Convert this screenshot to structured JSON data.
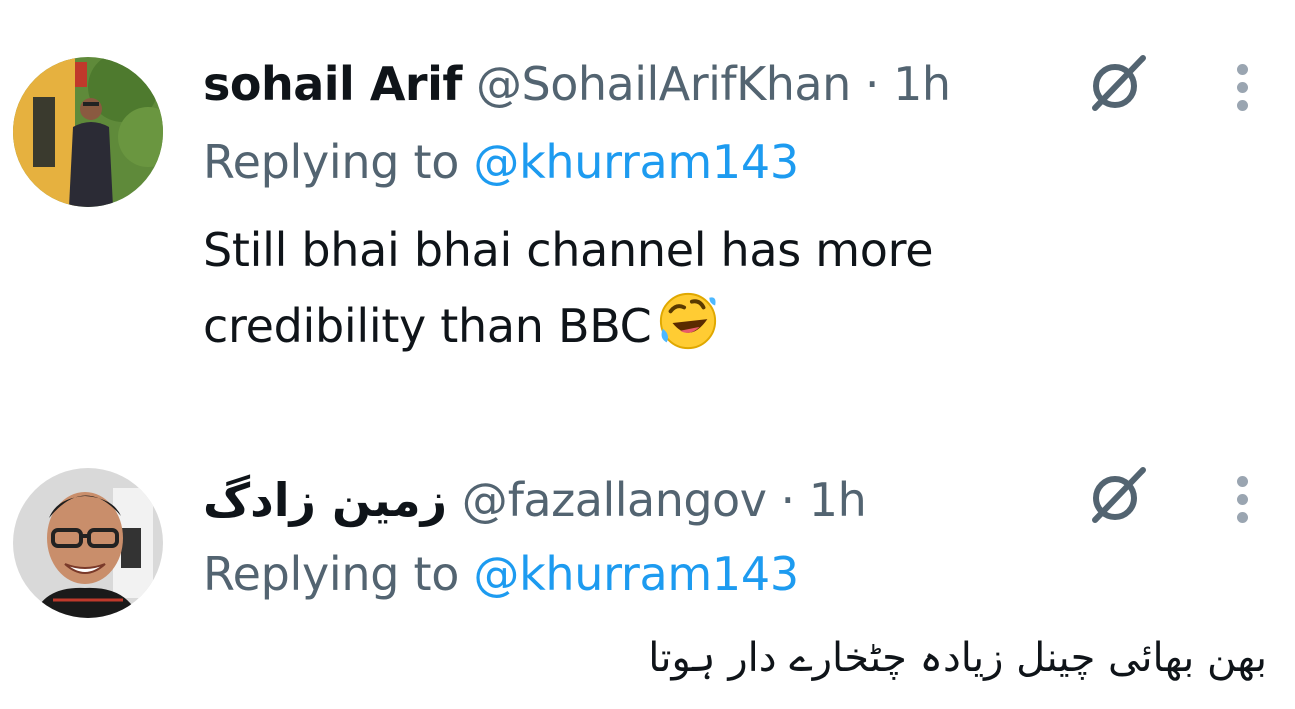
{
  "tweets": [
    {
      "display_name": "sohail Arif",
      "handle": "@SohailArifKhan",
      "separator": "·",
      "time": "1h",
      "replying_prefix": "Replying to",
      "replying_to": "@khurram143",
      "text_line1": "Still bhai bhai channel has more",
      "text_line2": "credibility than BBC",
      "emoji": "rolling-on-floor-laughing",
      "icons": [
        "grok-icon",
        "more-options-icon"
      ]
    },
    {
      "display_name": "زمین زادگ",
      "handle": "@fazallangov",
      "separator": "·",
      "time": "1h",
      "replying_prefix": "Replying to",
      "replying_to": "@khurram143",
      "text": "بھن بھائی  چینل زیادہ چٹخارے دار ہوتا",
      "icons": [
        "grok-icon",
        "more-options-icon"
      ]
    }
  ],
  "colors": {
    "text": "#0f1419",
    "secondary": "#536471",
    "link": "#1d9bf0",
    "icon": "#536471",
    "more_dots": "#9aa5b1"
  }
}
